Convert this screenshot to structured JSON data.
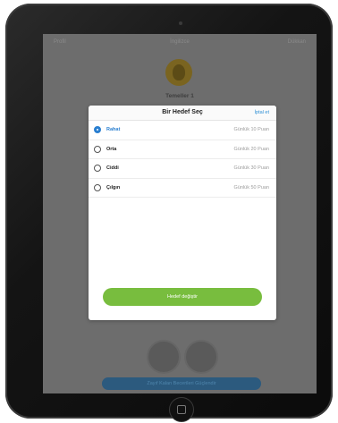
{
  "app": {
    "top_left": "Profil",
    "top_center": "İngilizce",
    "top_right": "Dükkan",
    "skill_label": "Temeller 1",
    "bottom_button": "Zayıf Kalan Becerileri Güçlendir"
  },
  "modal": {
    "title": "Bir Hedef Seç",
    "cancel_label": "İptal et",
    "options": [
      {
        "name": "Rahat",
        "points": "Günlük 10 Puan",
        "selected": true
      },
      {
        "name": "Orta",
        "points": "Günlük 20 Puan",
        "selected": false
      },
      {
        "name": "Ciddi",
        "points": "Günlük 30 Puan",
        "selected": false
      },
      {
        "name": "Çılgın",
        "points": "Günlük 50 Puan",
        "selected": false
      }
    ],
    "submit_label": "Hedef değiştir"
  },
  "colors": {
    "accent_blue": "#2a7fd0",
    "button_green": "#78bd3e",
    "overlay": "#6d6d6d"
  }
}
